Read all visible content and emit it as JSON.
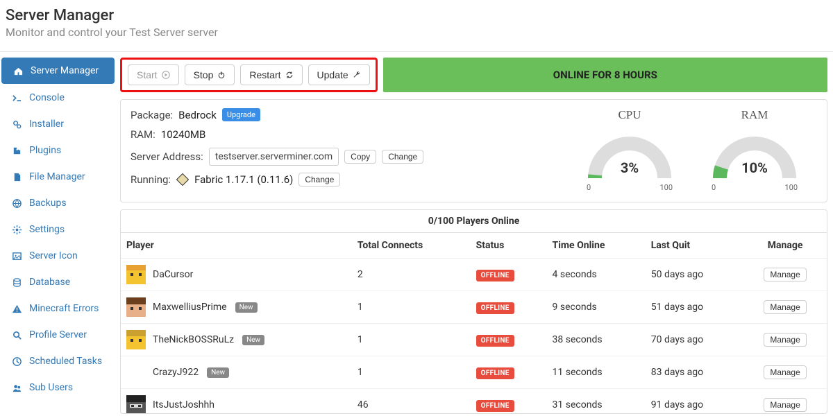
{
  "header": {
    "title": "Server Manager",
    "subtitle": "Monitor and control your Test Server server"
  },
  "sidebar": {
    "items": [
      {
        "icon": "home",
        "label": "Server Manager",
        "active": true
      },
      {
        "icon": "terminal",
        "label": "Console"
      },
      {
        "icon": "gears",
        "label": "Installer"
      },
      {
        "icon": "puzzle",
        "label": "Plugins"
      },
      {
        "icon": "file",
        "label": "File Manager"
      },
      {
        "icon": "globe",
        "label": "Backups"
      },
      {
        "icon": "cog",
        "label": "Settings"
      },
      {
        "icon": "image",
        "label": "Server Icon"
      },
      {
        "icon": "database",
        "label": "Database"
      },
      {
        "icon": "warning",
        "label": "Minecraft Errors"
      },
      {
        "icon": "search",
        "label": "Profile Server"
      },
      {
        "icon": "clock",
        "label": "Scheduled Tasks"
      },
      {
        "icon": "users",
        "label": "Sub Users"
      }
    ]
  },
  "actions": {
    "start": "Start",
    "stop": "Stop",
    "restart": "Restart",
    "update": "Update"
  },
  "status_bar": "ONLINE FOR 8 HOURS",
  "info": {
    "package_label": "Package:",
    "package_value": "Bedrock",
    "upgrade": "Upgrade",
    "ram_label": "RAM:",
    "ram_value": "10240MB",
    "addr_label": "Server Address:",
    "addr_value": "testserver.serverminer.com",
    "copy": "Copy",
    "change": "Change",
    "running_label": "Running:",
    "running_value": "Fabric 1.17.1 (0.11.6)"
  },
  "gauges": {
    "cpu": {
      "title": "CPU",
      "value": "3%",
      "pct": 3,
      "min": "0",
      "max": "100"
    },
    "ram": {
      "title": "RAM",
      "value": "10%",
      "pct": 10,
      "min": "0",
      "max": "100"
    }
  },
  "players_header": "0/100 Players Online",
  "table": {
    "cols": {
      "player": "Player",
      "connects": "Total Connects",
      "status": "Status",
      "time": "Time Online",
      "last": "Last Quit",
      "manage": "Manage"
    },
    "manage_btn": "Manage",
    "offline": "OFFLINE",
    "new": "New",
    "rows": [
      {
        "name": "DaCursor",
        "connects": "2",
        "status": "OFFLINE",
        "time": "4 seconds",
        "last": "50 days ago",
        "new": false,
        "avatar": "a1"
      },
      {
        "name": "MaxwelliusPrime",
        "connects": "1",
        "status": "OFFLINE",
        "time": "9 seconds",
        "last": "51 days ago",
        "new": true,
        "avatar": "a2"
      },
      {
        "name": "TheNickBOSSRuLz",
        "connects": "1",
        "status": "OFFLINE",
        "time": "38 seconds",
        "last": "70 days ago",
        "new": true,
        "avatar": "a3"
      },
      {
        "name": "CrazyJ922",
        "connects": "1",
        "status": "OFFLINE",
        "time": "11 seconds",
        "last": "83 days ago",
        "new": true,
        "avatar": "none"
      },
      {
        "name": "ItsJustJoshhh",
        "connects": "46",
        "status": "OFFLINE",
        "time": "31 seconds",
        "last": "91 days ago",
        "new": false,
        "avatar": "a4"
      }
    ]
  }
}
